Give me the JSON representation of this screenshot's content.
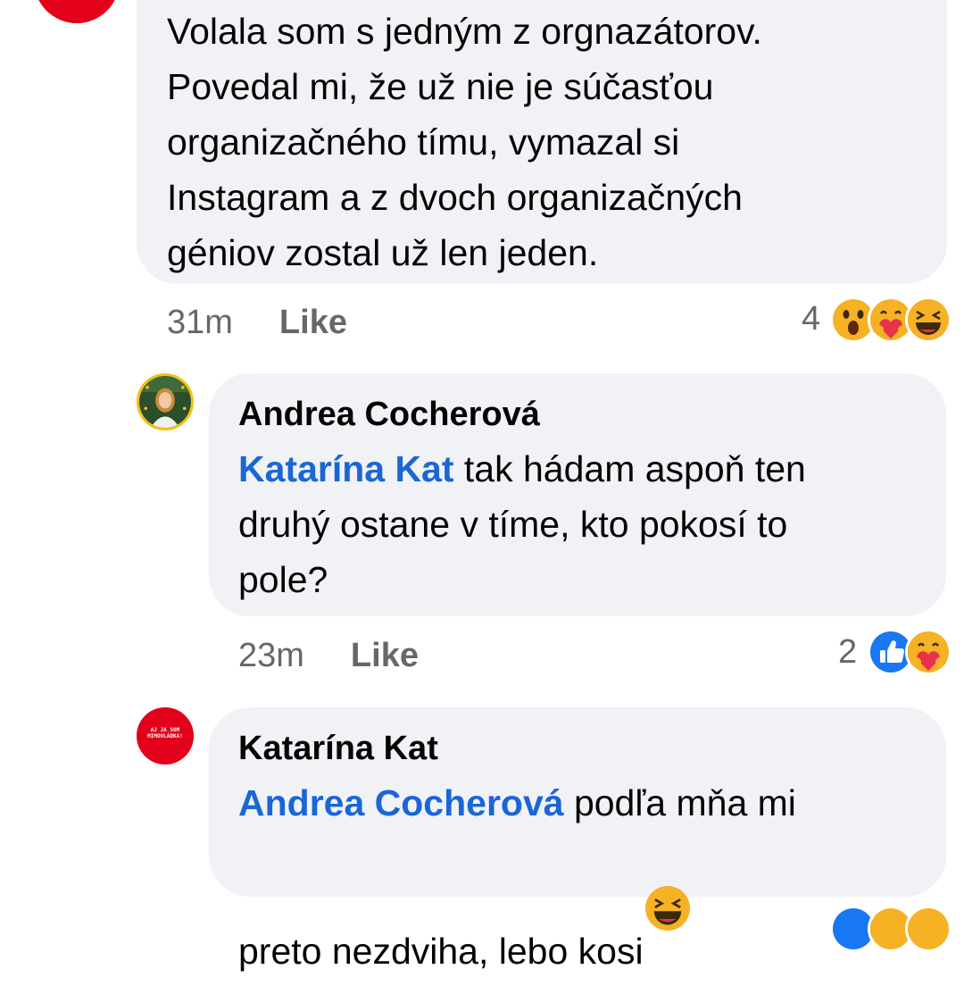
{
  "comment1": {
    "text": "Volala som s jedným z orgnazátorov.\nPovedal mi, že už nie je súčasťou\norganizačného tímu, vymazal si\nInstagram a z dvoch organizačných\ngéniov zostal už len jeden.",
    "time": "31m",
    "like_label": "Like",
    "reaction_count": "4",
    "reactions": [
      "wow-icon",
      "care-icon",
      "haha-icon"
    ]
  },
  "comment2": {
    "author": "Andrea Cocherová",
    "mention": "Katarína Kat",
    "text": " tak hádam aspoň ten\ndruhý ostane v tíme, kto pokosí to\npole?",
    "time": "23m",
    "like_label": "Like",
    "reaction_count": "2",
    "reactions": [
      "like-icon",
      "care-icon"
    ]
  },
  "comment3": {
    "author": "Katarína Kat",
    "mention": "Andrea Cocherová",
    "text": " podľa mňa mi\npreto nezdviha, lebo kosi",
    "reactions": [
      "like-icon",
      "care-icon",
      "haha-icon"
    ],
    "avatar_text": "AJ JA SOM\nMIMOVLÁDKA!"
  },
  "colors": {
    "bubble": "#f0f2f5",
    "mention": "#1b66d6",
    "meta": "#65676b",
    "brand_red": "#e2001a"
  }
}
